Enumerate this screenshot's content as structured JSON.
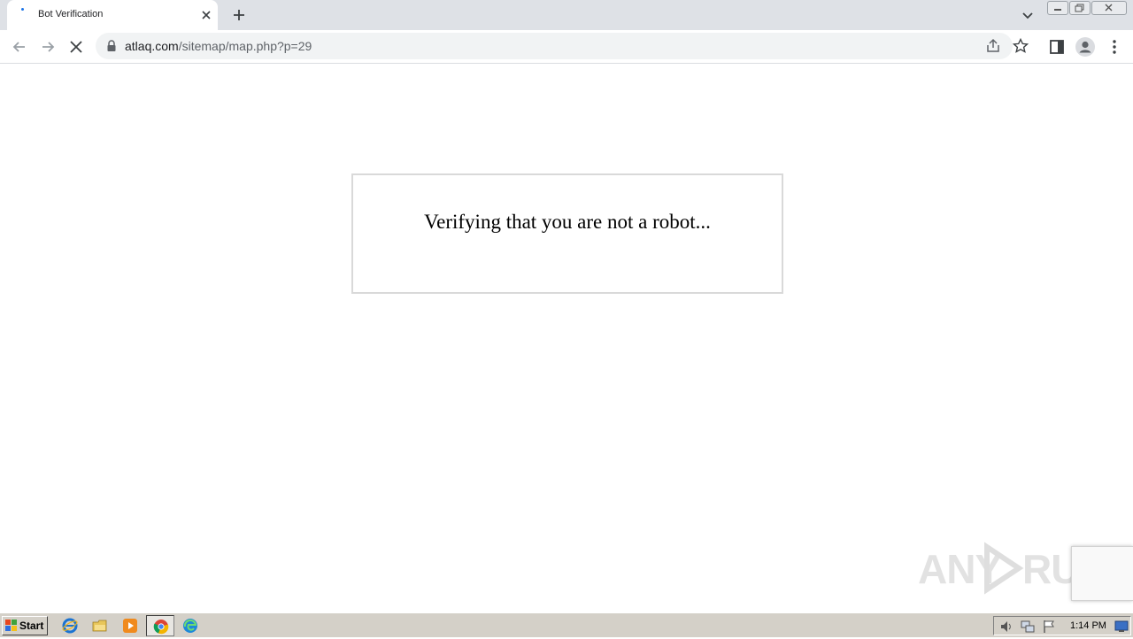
{
  "browser": {
    "tab": {
      "title": "Bot Verification"
    },
    "url": {
      "host": "atlaq.com",
      "path": "/sitemap/map.php?p=29"
    }
  },
  "page": {
    "message": "Verifying that you are not a robot..."
  },
  "watermark": {
    "left": "ANY",
    "right": "RUN"
  },
  "taskbar": {
    "start_label": "Start",
    "clock": "1:14 PM"
  },
  "colors": {
    "tabstrip": "#dee1e6",
    "omnibox": "#f1f3f4",
    "taskbar": "#d4d0c8",
    "accent": "#1a73e8"
  },
  "icons": {
    "tab": [
      "loading-favicon-icon",
      "close-icon",
      "plus-icon",
      "chevron-down-icon"
    ],
    "window": [
      "minimize-icon",
      "restore-icon",
      "close-icon"
    ],
    "toolbar": [
      "arrow-left-icon",
      "arrow-right-icon",
      "stop-icon",
      "lock-icon",
      "share-icon",
      "star-icon",
      "side-panel-icon",
      "profile-icon",
      "kebab-menu-icon"
    ],
    "taskbar": [
      "windows-logo-icon",
      "internet-explorer-icon",
      "folder-icon",
      "media-player-icon",
      "chrome-icon",
      "edge-icon",
      "speaker-icon",
      "network-icon",
      "flag-icon",
      "desktop-icon"
    ]
  }
}
